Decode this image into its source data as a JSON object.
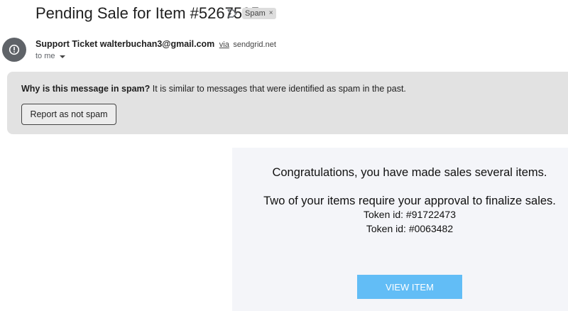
{
  "subject": {
    "title": "Pending Sale for Item #5267595",
    "importance_icon": "importance-marker-icon",
    "label": "Spam",
    "label_remove": "×"
  },
  "sender": {
    "avatar_icon": "alert-circle-icon",
    "name": "Support Ticket walterbuchan3@gmail.com",
    "via": "via",
    "via_domain": "sendgrid.net",
    "recipient": "to me",
    "recipient_icon": "chevron-down-icon"
  },
  "spam_banner": {
    "question": "Why is this message in spam?",
    "explanation": "It is similar to messages that were identified as spam in the past.",
    "button": "Report as not spam"
  },
  "body": {
    "congrats": "Congratulations, you have made sales several items.",
    "approval": "Two of your items require your approval to finalize sales.",
    "token1": "Token id: #91722473",
    "token2": "Token id: #0063482",
    "button": "VIEW ITEM"
  },
  "colors": {
    "banner_bg": "#e2e2e2",
    "body_bg": "#f4f5f9",
    "view_button": "#62bdf6",
    "avatar": "#5f6368"
  }
}
